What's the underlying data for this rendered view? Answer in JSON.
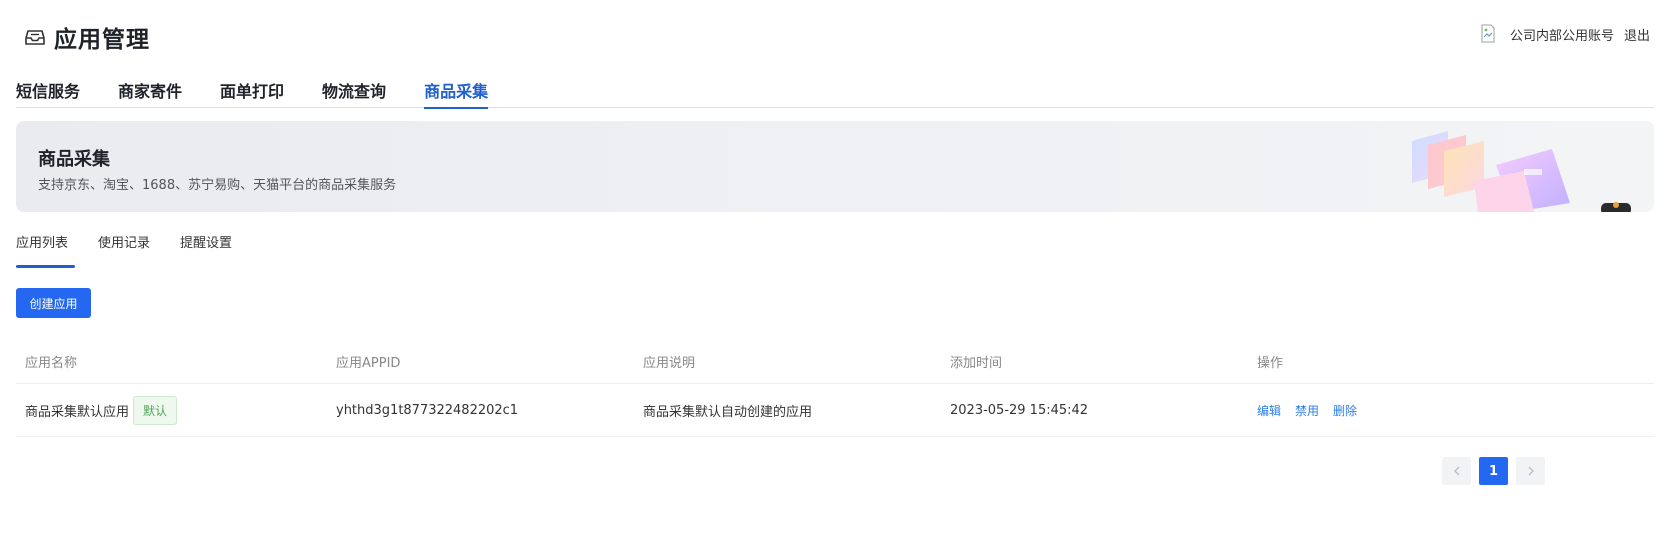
{
  "header": {
    "title": "应用管理",
    "title_icon": "inbox-icon",
    "user_name": "公司内部公用账号",
    "logout_label": "退出"
  },
  "main_tabs": [
    {
      "label": "短信服务",
      "active": false
    },
    {
      "label": "商家寄件",
      "active": false
    },
    {
      "label": "面单打印",
      "active": false
    },
    {
      "label": "物流查询",
      "active": false
    },
    {
      "label": "商品采集",
      "active": true
    }
  ],
  "banner": {
    "title": "商品采集",
    "subtitle": "支持京东、淘宝、1688、苏宁易购、天猫平台的商品采集服务"
  },
  "sub_tabs": [
    {
      "label": "应用列表",
      "active": true
    },
    {
      "label": "使用记录",
      "active": false
    },
    {
      "label": "提醒设置",
      "active": false
    }
  ],
  "create_button_label": "创建应用",
  "table": {
    "headers": [
      "应用名称",
      "应用APPID",
      "应用说明",
      "添加时间",
      "操作"
    ],
    "rows": [
      {
        "name": "商品采集默认应用",
        "badge": "默认",
        "appid": "yhthd3g1t877322482202c1",
        "description": "商品采集默认自动创建的应用",
        "added_time": "2023-05-29 15:45:42",
        "actions": [
          "编辑",
          "禁用",
          "删除"
        ]
      }
    ]
  },
  "pagination": {
    "prev_icon": "chevron-left-icon",
    "current_page": "1",
    "next_icon": "chevron-right-icon"
  },
  "colors": {
    "primary": "#2468f2",
    "active_tab": "#1f5fd0",
    "link": "#2c7ee6",
    "badge_text": "#52a35b"
  }
}
